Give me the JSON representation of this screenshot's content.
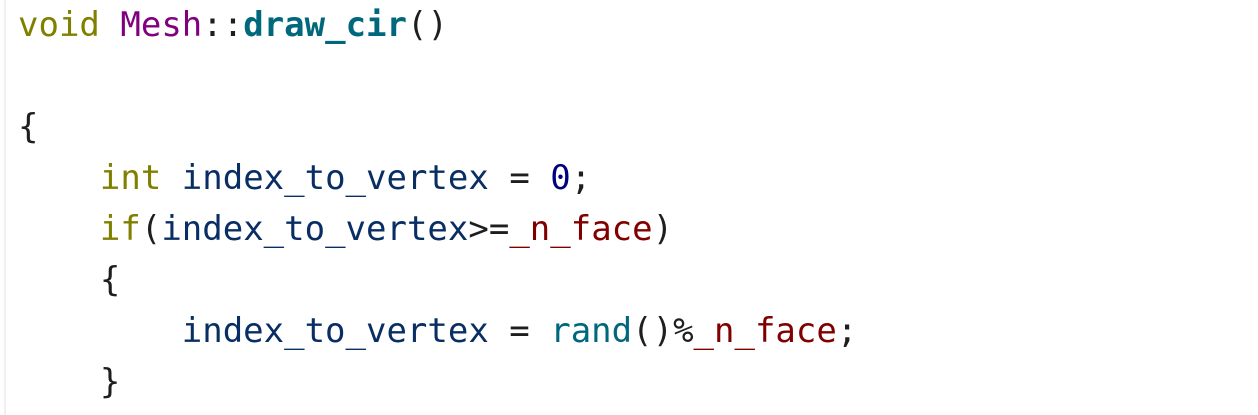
{
  "editor": {
    "lines": [
      {
        "indent": "",
        "tokens": [
          {
            "kind": "type",
            "text": "void"
          },
          {
            "kind": "punct",
            "text": " "
          },
          {
            "kind": "class",
            "text": "Mesh"
          },
          {
            "kind": "punct",
            "text": "::"
          },
          {
            "kind": "func",
            "text": "draw_cir"
          },
          {
            "kind": "punct",
            "text": "()"
          }
        ]
      },
      {
        "indent": "",
        "tokens": []
      },
      {
        "indent": "",
        "tokens": [
          {
            "kind": "punct",
            "text": "{"
          }
        ]
      },
      {
        "indent": "    ",
        "tokens": [
          {
            "kind": "type",
            "text": "int"
          },
          {
            "kind": "punct",
            "text": " "
          },
          {
            "kind": "var",
            "text": "index_to_vertex"
          },
          {
            "kind": "punct",
            "text": " = "
          },
          {
            "kind": "number",
            "text": "0"
          },
          {
            "kind": "punct",
            "text": ";"
          }
        ]
      },
      {
        "indent": "    ",
        "tokens": [
          {
            "kind": "type",
            "text": "if"
          },
          {
            "kind": "punct",
            "text": "("
          },
          {
            "kind": "var",
            "text": "index_to_vertex"
          },
          {
            "kind": "punct",
            "text": ">="
          },
          {
            "kind": "member",
            "text": "_n_face"
          },
          {
            "kind": "punct",
            "text": ")"
          }
        ]
      },
      {
        "indent": "    ",
        "tokens": [
          {
            "kind": "punct",
            "text": "{"
          }
        ]
      },
      {
        "indent": "        ",
        "tokens": [
          {
            "kind": "var",
            "text": "index_to_vertex"
          },
          {
            "kind": "punct",
            "text": " = "
          },
          {
            "kind": "call",
            "text": "rand"
          },
          {
            "kind": "punct",
            "text": "()%"
          },
          {
            "kind": "member",
            "text": "_n_face"
          },
          {
            "kind": "punct",
            "text": ";"
          }
        ]
      },
      {
        "indent": "    ",
        "tokens": [
          {
            "kind": "punct",
            "text": "}"
          }
        ]
      }
    ]
  }
}
